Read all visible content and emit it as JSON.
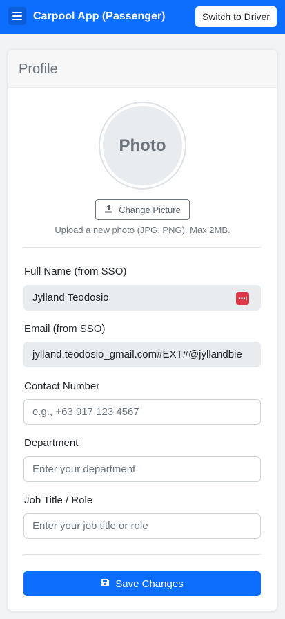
{
  "navbar": {
    "menu_icon": "hamburger-icon",
    "title": "Carpool App (Passenger)",
    "switch_label": "Switch to Driver"
  },
  "profile": {
    "header": "Profile",
    "photo_label": "Photo",
    "change_picture_label": "Change Picture",
    "change_picture_icon": "upload-icon",
    "upload_hint": "Upload a new photo (JPG, PNG). Max 2MB."
  },
  "fields": {
    "full_name": {
      "label": "Full Name (from SSO)",
      "value": "Jylland Teodosio",
      "icon": "password-manager-icon"
    },
    "email": {
      "label": "Email (from SSO)",
      "value": "jylland.teodosio_gmail.com#EXT#@jyllandbie"
    },
    "contact": {
      "label": "Contact Number",
      "placeholder": "e.g., +63 917 123 4567"
    },
    "department": {
      "label": "Department",
      "placeholder": "Enter your department"
    },
    "job_title": {
      "label": "Job Title / Role",
      "placeholder": "Enter your job title or role"
    }
  },
  "save": {
    "label": "Save Changes",
    "icon": "floppy-disk-icon"
  },
  "colors": {
    "primary": "#0d6efd",
    "danger": "#dc3545",
    "muted": "#6c757d"
  }
}
